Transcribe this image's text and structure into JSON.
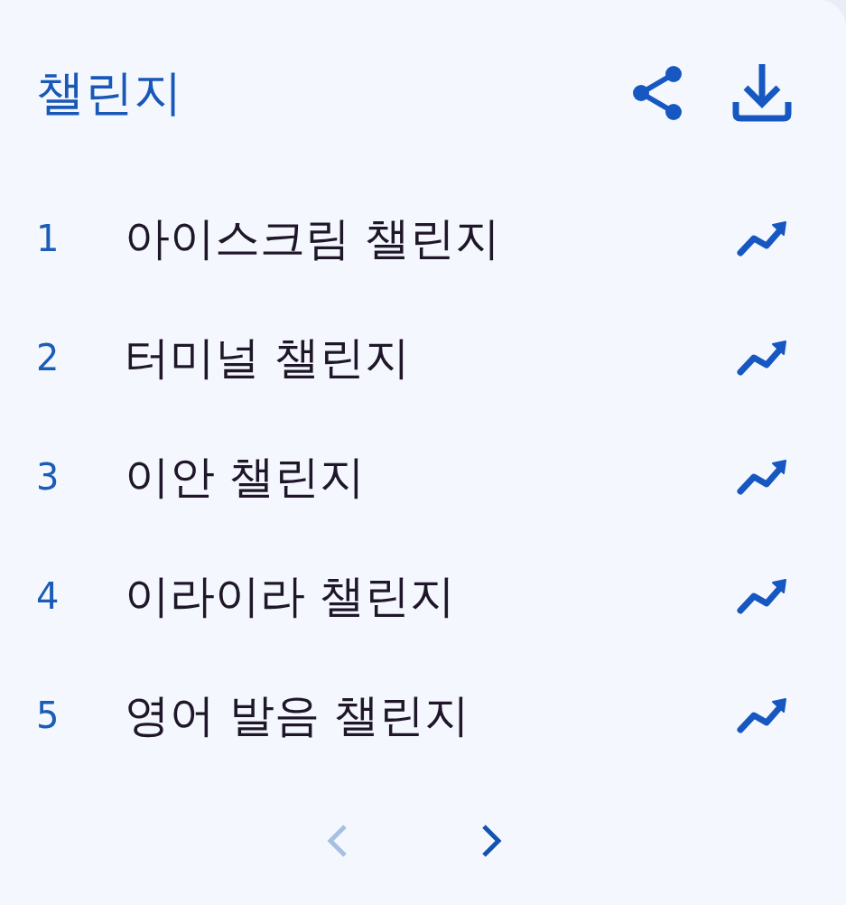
{
  "header": {
    "title": "챌린지"
  },
  "trends": [
    {
      "rank": "1",
      "label": "아이스크림 챌린지"
    },
    {
      "rank": "2",
      "label": "터미널 챌린지"
    },
    {
      "rank": "3",
      "label": "이안 챌린지"
    },
    {
      "rank": "4",
      "label": "이라이라 챌린지"
    },
    {
      "rank": "5",
      "label": "영어 발음 챌린지"
    }
  ],
  "pagination": [
    {
      "kind": "prev",
      "disabled": true
    },
    {
      "kind": "next",
      "disabled": false
    }
  ]
}
